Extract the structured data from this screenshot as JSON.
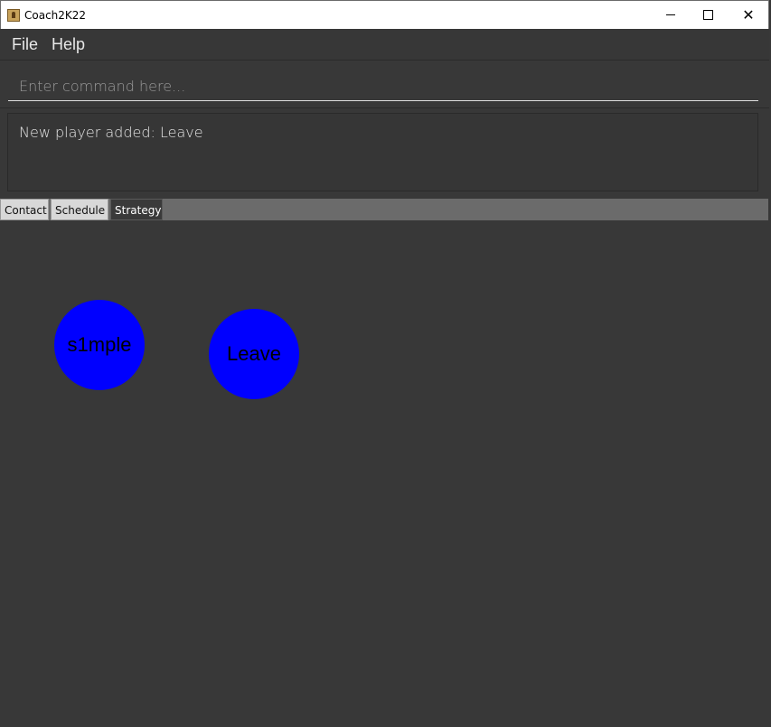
{
  "window": {
    "title": "Coach2K22"
  },
  "menu": {
    "file": "File",
    "help": "Help"
  },
  "command": {
    "placeholder": "Enter command here...",
    "value": ""
  },
  "result": {
    "text": "New player added: Leave"
  },
  "tabs": [
    {
      "label": "Contact",
      "active": false
    },
    {
      "label": "Schedule",
      "active": false
    },
    {
      "label": "Strategy",
      "active": true
    }
  ],
  "strategy": {
    "players": [
      {
        "name": "s1mple",
        "color": "#0000ff"
      },
      {
        "name": "Leave",
        "color": "#0000ff"
      }
    ]
  }
}
